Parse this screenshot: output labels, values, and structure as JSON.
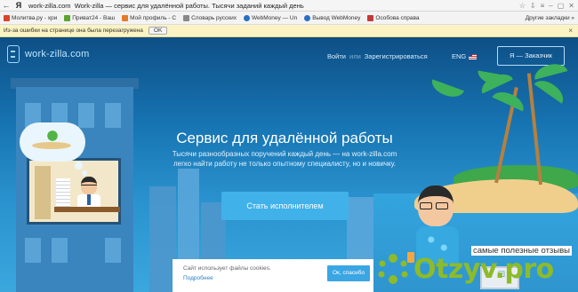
{
  "browser": {
    "back_icon": "back-arrow-icon",
    "ya_logo": "Я",
    "url_domain": "work-zilla.com",
    "url_title": "Work-zilla — сервис для удалённой работы. Тысячи заданий каждый день",
    "right_icons": [
      "bookmark-star-icon",
      "download-icon",
      "menu-icon",
      "minimize-icon",
      "maximize-icon",
      "close-icon"
    ]
  },
  "bookmarks": {
    "items": [
      {
        "label": "Молитва.ру - хри",
        "color": "#d9442a"
      },
      {
        "label": "Приват24 - Ваш",
        "color": "#5ca330"
      },
      {
        "label": "Мой профиль - С",
        "color": "#e47b2a"
      },
      {
        "label": "Словарь русских",
        "color": "#888888"
      },
      {
        "label": "WebMoney — Un",
        "color": "#2a6fc4"
      },
      {
        "label": "Вывод WebMoney",
        "color": "#2a6fc4"
      },
      {
        "label": "Особова справа",
        "color": "#c33a3a"
      }
    ],
    "other": "Другие закладки"
  },
  "infobar": {
    "message": "Из-за ошибки на странице она была перезагружена",
    "ok_label": "OK",
    "close": "×"
  },
  "site": {
    "logo_text": "work-zilla.com",
    "login": "Войти",
    "or": "или",
    "register": "Зарегистрироваться",
    "lang": "ENG",
    "customer_button": "Я — Заказчик",
    "hero_title": "Сервис для удалённой работы",
    "hero_subtitle": "Тысячи разнообразных поручений каждый день — на work-zilla.com легко найти работу не только опытному специалисту, но и новичку.",
    "cta": "Стать исполнителем"
  },
  "cookie": {
    "message": "Сайт использует файлы cookies.",
    "more": "Подробнее",
    "ok": "Ок, спасибо"
  },
  "watermark": {
    "tagline": "самые полезные отзывы",
    "brand": "Otzyv.pro",
    "brand_color": "#8dbb2a"
  }
}
